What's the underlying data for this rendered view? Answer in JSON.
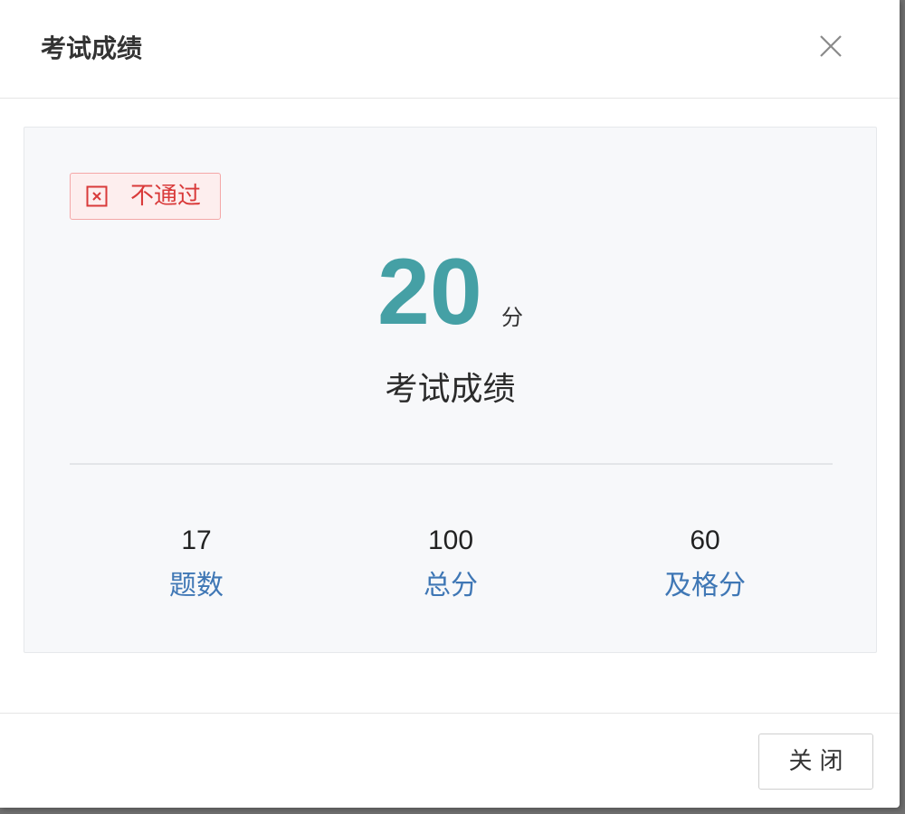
{
  "dialog": {
    "title": "考试成绩",
    "close_icon": "close-icon"
  },
  "result": {
    "status": {
      "label": "不通过",
      "icon": "close-square-icon",
      "color": "#d93a3a",
      "background": "#fdeeee"
    },
    "score": "20",
    "score_unit": "分",
    "score_label": "考试成绩",
    "score_color": "#45a0a5",
    "stats": [
      {
        "value": "17",
        "label": "题数"
      },
      {
        "value": "100",
        "label": "总分"
      },
      {
        "value": "60",
        "label": "及格分"
      }
    ],
    "stat_label_color": "#3f77b5"
  },
  "footer": {
    "close_button_label": "关闭"
  }
}
